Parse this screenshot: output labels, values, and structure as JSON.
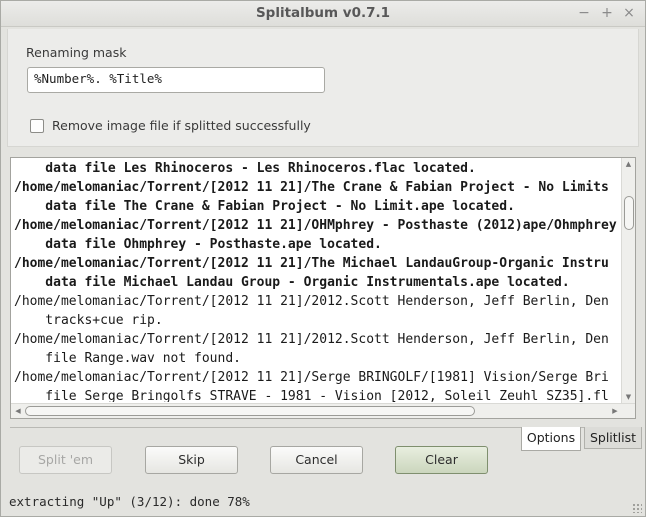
{
  "window": {
    "title": "Splitalbum v0.7.1",
    "controls": {
      "minimize": "−",
      "maximize": "+",
      "close": "×"
    }
  },
  "options": {
    "mask_label": "Renaming mask",
    "mask_value": "%Number%. %Title%",
    "remove_image_label": "Remove image file if splitted successfully",
    "remove_image_checked": false
  },
  "log": {
    "lines": [
      {
        "text": "    data file Les Rhinoceros - Les Rhinoceros.flac located.",
        "bold": true
      },
      {
        "text": "/home/melomaniac/Torrent/[2012 11 21]/The Crane & Fabian Project - No Limits",
        "bold": true
      },
      {
        "text": "    data file The Crane & Fabian Project - No Limit.ape located.",
        "bold": true
      },
      {
        "text": "/home/melomaniac/Torrent/[2012 11 21]/OHMphrey - Posthaste (2012)ape/Ohmphrey",
        "bold": true
      },
      {
        "text": "    data file Ohmphrey - Posthaste.ape located.",
        "bold": true
      },
      {
        "text": "/home/melomaniac/Torrent/[2012 11 21]/The Michael LandauGroup-Organic Instru",
        "bold": true
      },
      {
        "text": "    data file Michael Landau Group - Organic Instrumentals.ape located.",
        "bold": true
      },
      {
        "text": "/home/melomaniac/Torrent/[2012 11 21]/2012.Scott Henderson, Jeff Berlin, Den",
        "bold": false
      },
      {
        "text": "    tracks+cue rip.",
        "bold": false
      },
      {
        "text": "/home/melomaniac/Torrent/[2012 11 21]/2012.Scott Henderson, Jeff Berlin, Den",
        "bold": false
      },
      {
        "text": "    file Range.wav not found.",
        "bold": false
      },
      {
        "text": "/home/melomaniac/Torrent/[2012 11 21]/Serge BRINGOLF/[1981] Vision/Serge Bri",
        "bold": false
      },
      {
        "text": "    file Serge Bringolfs STRAVE - 1981 - Vision [2012, Soleil Zeuhl SZ35].fl",
        "bold": false
      }
    ]
  },
  "tabs": [
    {
      "label": "Options",
      "active": true
    },
    {
      "label": "Splitlist",
      "active": false
    }
  ],
  "buttons": {
    "split": "Split 'em",
    "skip": "Skip",
    "cancel": "Cancel",
    "clear": "Clear"
  },
  "status": "extracting \"Up\" (3/12): done 78%"
}
